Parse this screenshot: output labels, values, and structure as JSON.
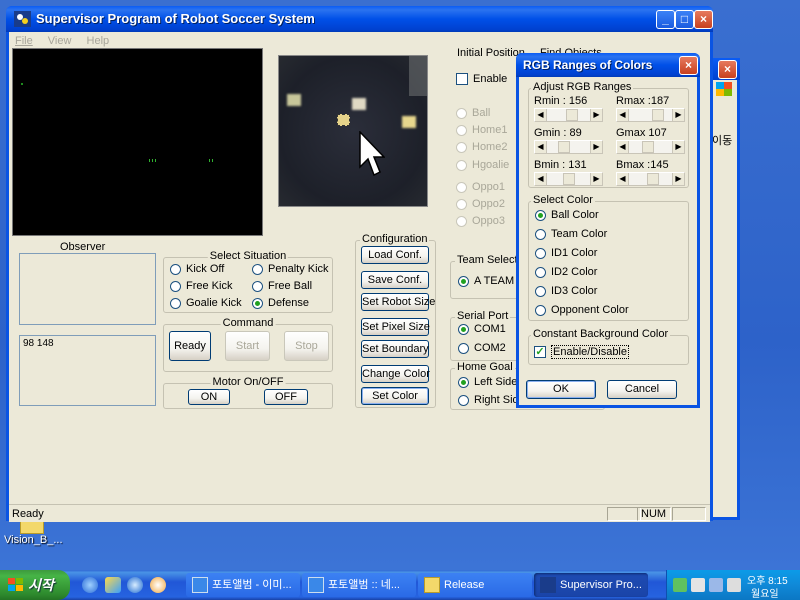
{
  "desktop": {
    "icon_label": "Vision_B_..."
  },
  "main_window": {
    "title": "Supervisor Program of Robot Soccer System",
    "menu": [
      "File",
      "View",
      "Help"
    ],
    "observer": {
      "title": "Observer",
      "readout": "98 148"
    },
    "select_situation": {
      "title": "Select Situation",
      "options": [
        "Kick Off",
        "Penalty Kick",
        "Free Kick",
        "Free Ball",
        "Goalie Kick",
        "Defense"
      ],
      "selected": "Defense"
    },
    "command": {
      "title": "Command",
      "buttons": [
        "Ready",
        "Start",
        "Stop"
      ]
    },
    "motor": {
      "title": "Motor On/OFF",
      "buttons": [
        "ON",
        "OFF"
      ]
    },
    "configuration": {
      "title": "Configuration",
      "buttons": [
        "Load Conf.",
        "Save Conf.",
        "Set Robot Size",
        "Set Pixel Size",
        "Set Boundary",
        "Change Color",
        "Set Color"
      ]
    },
    "initial_position": {
      "title": "Initial Position",
      "enable_label": "Enable",
      "enable_checked": false
    },
    "find_objects": {
      "title": "Find Objects",
      "options": [
        "Ball",
        "Home1",
        "Home2",
        "Hgoalie",
        "Oppo1",
        "Oppo2",
        "Oppo3"
      ]
    },
    "team_select": {
      "title": "Team Select",
      "selected_label": "A  TEAM"
    },
    "serial_port": {
      "title": "Serial Port",
      "options": [
        "COM1",
        "COM2"
      ],
      "selected": "COM1"
    },
    "home_goal": {
      "title": "Home Goal",
      "options": [
        "Left Side",
        "Right Side"
      ],
      "selected": "Left Side"
    },
    "status": {
      "text": "Ready",
      "num": "NUM"
    }
  },
  "background_window": {
    "fragment_text": "이동"
  },
  "dialog": {
    "title": "RGB Ranges of Colors",
    "adjust": {
      "title": "Adjust  RGB   Ranges",
      "sliders": [
        {
          "label": "Rmin :",
          "value": "156",
          "level": 0.61
        },
        {
          "label": "Rmax :",
          "value": "187",
          "level": 0.73
        },
        {
          "label": "Gmin :",
          "value": "89",
          "level": 0.35
        },
        {
          "label": "Gmax",
          "value": "107",
          "level": 0.42
        },
        {
          "label": "Bmin :",
          "value": "131",
          "level": 0.51
        },
        {
          "label": "Bmax :",
          "value": "145",
          "level": 0.57
        }
      ]
    },
    "select_color": {
      "title": "Select  Color",
      "options": [
        "Ball Color",
        "Team Color",
        "ID1 Color",
        "ID2 Color",
        "ID3 Color",
        "Opponent Color"
      ],
      "selected": "Ball Color"
    },
    "constant_bg": {
      "title": "Constant Background Color",
      "checkbox_label": "Enable/Disable",
      "checked": true
    },
    "ok_label": "OK",
    "cancel_label": "Cancel"
  },
  "taskbar": {
    "start_label": "시작",
    "tasks": [
      {
        "label": "포토앨범 - 이미...",
        "active": false
      },
      {
        "label": "포토앨범 :: 네...",
        "active": false
      },
      {
        "label": "Release",
        "active": false
      },
      {
        "label": "Supervisor Pro...",
        "active": true
      }
    ],
    "clock_time": "오후 8:15",
    "clock_day": "월요일"
  }
}
